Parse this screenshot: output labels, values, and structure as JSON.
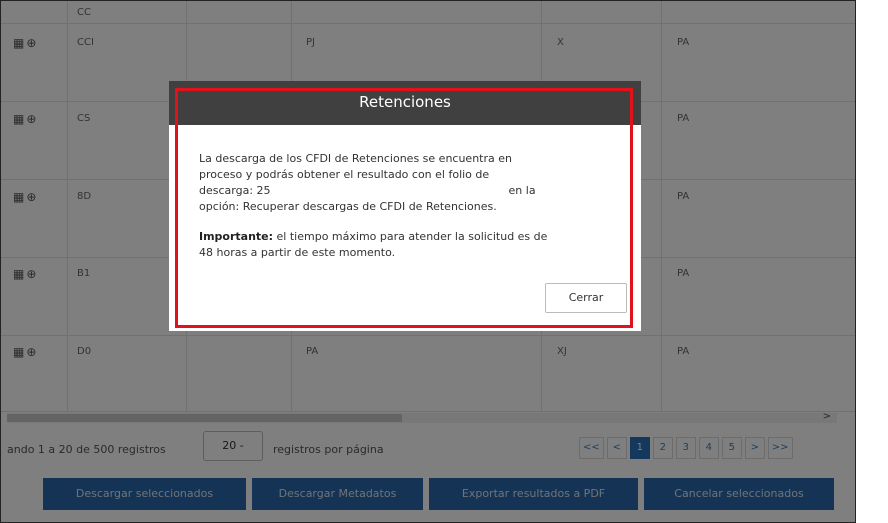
{
  "rows": [
    {
      "id": "CC",
      "c3": "",
      "c4": "",
      "c5": "",
      "show_icons": false
    },
    {
      "id": "CCI",
      "c3": "PJ",
      "c4": "X",
      "c5": "PA",
      "show_icons": true
    },
    {
      "id": "CS",
      "c3": "",
      "c4": "",
      "c5": "PA",
      "show_icons": true
    },
    {
      "id": "8D",
      "c3": "",
      "c4": "",
      "c5": "PA",
      "show_icons": true
    },
    {
      "id": "B1",
      "c3": "",
      "c4": "",
      "c5": "PA",
      "show_icons": true
    },
    {
      "id": "D0",
      "c3": "PA",
      "c4": "XJ",
      "c5": "PA",
      "show_icons": true
    }
  ],
  "row_icons": "▦⊕",
  "pager": {
    "showing_text": "ando 1 a 20 de 500 registros",
    "page_size": "20 -",
    "per_page_text": "registros por página",
    "pages": [
      "<<",
      "<",
      "1",
      "2",
      "3",
      "4",
      "5",
      ">",
      ">>"
    ],
    "active_page": "1"
  },
  "scroll_arrow": ">",
  "actions": {
    "download_selected": "Descargar seleccionados",
    "download_metadata": "Descargar Metadatos",
    "export_pdf": "Exportar resultados a PDF",
    "cancel_selected": "Cancelar seleccionados"
  },
  "modal": {
    "title": "Retenciones",
    "line1": "La descarga de los CFDI de Retenciones se encuentra en",
    "line2": "proceso y podrás obtener el resultado con el folio de",
    "line3a": "descarga: 25",
    "line3b": "en la",
    "line4": "opción: Recuperar descargas de CFDI de Retenciones.",
    "important_label": "Importante:",
    "important_text": " el tiempo máximo para atender la solicitud es de",
    "important_line2": "48 horas a partir de este momento.",
    "close_label": "Cerrar"
  },
  "colors": {
    "modal_header": "#404040",
    "highlight_border": "#e0121b",
    "action_button": "#2a66a8",
    "active_page": "#2b72b8"
  }
}
